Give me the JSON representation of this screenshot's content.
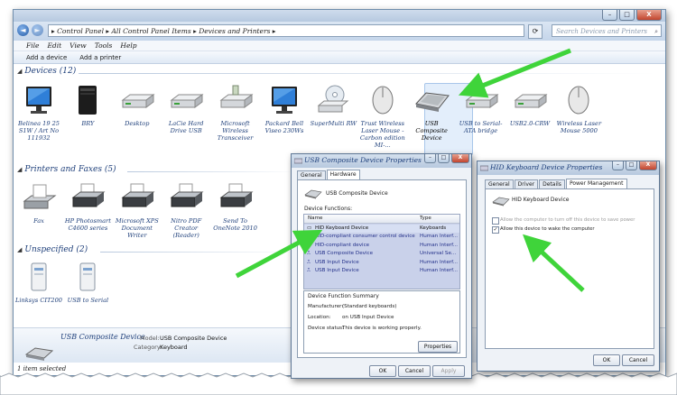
{
  "window": {
    "address": "▸ Control Panel ▸ All Control Panel Items ▸ Devices and Printers ▸",
    "search_placeholder": "Search Devices and Printers",
    "nav_back": "◄",
    "nav_forward": "►",
    "controls": {
      "minimize": "–",
      "maximize": "□",
      "close": "X"
    }
  },
  "menu": [
    "File",
    "Edit",
    "View",
    "Tools",
    "Help"
  ],
  "commands": {
    "add_device": "Add a device",
    "add_printer": "Add a printer"
  },
  "groups": {
    "devices": "Devices (12)",
    "printers": "Printers and Faxes (5)",
    "unspecified": "Unspecified (2)"
  },
  "devices": [
    {
      "label": "Belinea 19 25 S1W / Art No 111932",
      "icon": "monitor-icon"
    },
    {
      "label": "BRY",
      "icon": "computer-tower-icon"
    },
    {
      "label": "Desktop",
      "icon": "drive-icon"
    },
    {
      "label": "LaCie Hard Drive USB",
      "icon": "drive-icon"
    },
    {
      "label": "Microsoft Wireless Transceiver",
      "icon": "usb-drive-icon"
    },
    {
      "label": "Packard Bell Viseo 230Ws",
      "icon": "monitor-icon"
    },
    {
      "label": "SuperMulti RW",
      "icon": "optical-drive-icon"
    },
    {
      "label": "Trust Wireless Laser Mouse - Carbon edition MI-...",
      "icon": "mouse-icon"
    },
    {
      "label": "USB Composite Device",
      "icon": "keyboard-icon"
    },
    {
      "label": "USB to Serial-ATA bridge",
      "icon": "drive-icon"
    },
    {
      "label": "USB2.0-CRW",
      "icon": "drive-icon"
    },
    {
      "label": "Wireless Laser Mouse 5000",
      "icon": "mouse-icon"
    }
  ],
  "printers": [
    {
      "label": "Fax",
      "icon": "fax-icon"
    },
    {
      "label": "HP Photosmart C4600 series",
      "icon": "printer-icon"
    },
    {
      "label": "Microsoft XPS Document Writer",
      "icon": "printer-icon"
    },
    {
      "label": "Nitro PDF Creator (Reader)",
      "icon": "printer-icon"
    },
    {
      "label": "Send To OneNote 2010",
      "icon": "printer-icon"
    }
  ],
  "unspecified": [
    {
      "label": "Linksys CIT200",
      "icon": "generic-device-icon"
    },
    {
      "label": "USB to Serial",
      "icon": "generic-device-icon"
    }
  ],
  "status": {
    "device_name": "USB Composite Device",
    "model_key": "Model:",
    "model_value": "USB Composite Device",
    "category_key": "Category:",
    "category_value": "Keyboard",
    "footer": "1 item selected"
  },
  "dialog1": {
    "title": "USB Composite Device Properties",
    "tabs": [
      "General",
      "Hardware"
    ],
    "active_tab": "Hardware",
    "device_name": "USB Composite Device",
    "functions_label": "Device Functions:",
    "col_name": "Name",
    "col_type": "Type",
    "rows": [
      {
        "name": "HID Keyboard Device",
        "type": "Keyboards"
      },
      {
        "name": "HID-compliant consumer control device",
        "type": "Human Interf..."
      },
      {
        "name": "HID-compliant device",
        "type": "Human Interf..."
      },
      {
        "name": "USB Composite Device",
        "type": "Universal Se..."
      },
      {
        "name": "USB Input Device",
        "type": "Human Interf..."
      },
      {
        "name": "USB Input Device",
        "type": "Human Interf..."
      }
    ],
    "summary_title": "Device Function Summary",
    "manufacturer_key": "Manufacturer:",
    "manufacturer_value": "(Standard keyboards)",
    "location_key": "Location:",
    "location_value": "on USB Input Device",
    "status_key": "Device status:",
    "status_value": "This device is working properly.",
    "properties_btn": "Properties",
    "ok": "OK",
    "cancel": "Cancel",
    "apply": "Apply"
  },
  "dialog2": {
    "title": "HID Keyboard Device Properties",
    "tabs": [
      "General",
      "Driver",
      "Details",
      "Power Management"
    ],
    "active_tab": "Power Management",
    "device_name": "HID Keyboard Device",
    "opt1": "Allow the computer to turn off this device to save power",
    "opt2": "Allow this device to wake the computer",
    "opt1_checked": false,
    "opt2_checked": true,
    "ok": "OK",
    "cancel": "Cancel"
  },
  "colors": {
    "arrow": "#3fd43a",
    "link_blue": "#1e3f7a",
    "selection": "#e3eefb"
  }
}
